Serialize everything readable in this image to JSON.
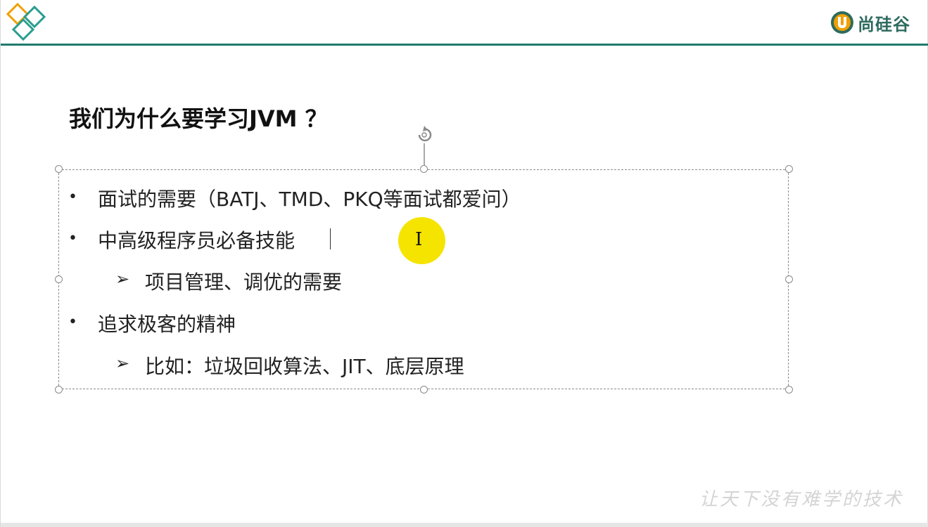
{
  "header": {
    "brand_name": "尚硅谷",
    "brand_logo_icon": "u-logo-icon",
    "corner_logo_icon": "diamond-logo-icon",
    "accent_color": "#1f7a6e",
    "logo_color": "#2e6b5e",
    "logo_orange": "#f0a000"
  },
  "slide": {
    "title": "我们为什么要学习JVM ？",
    "items": [
      {
        "level": 1,
        "text": "面试的需要（BATJ、TMD、PKQ等面试都爱问）"
      },
      {
        "level": 1,
        "text": "中高级程序员必备技能"
      },
      {
        "level": 2,
        "text": "项目管理、调优的需要"
      },
      {
        "level": 1,
        "text": "追求极客的精神"
      },
      {
        "level": 2,
        "text": "比如：垃圾回收算法、JIT、底层原理"
      }
    ],
    "bullet_symbol": "•",
    "sub_bullet_symbol": "➢"
  },
  "footer": {
    "watermark": "让天下没有难学的技术"
  },
  "cursor": {
    "highlight_color": "#f5e400",
    "cursor_icon": "text-cursor-icon",
    "glyph": "I"
  },
  "textbox": {
    "rotate_icon": "rotate-handle-icon"
  }
}
